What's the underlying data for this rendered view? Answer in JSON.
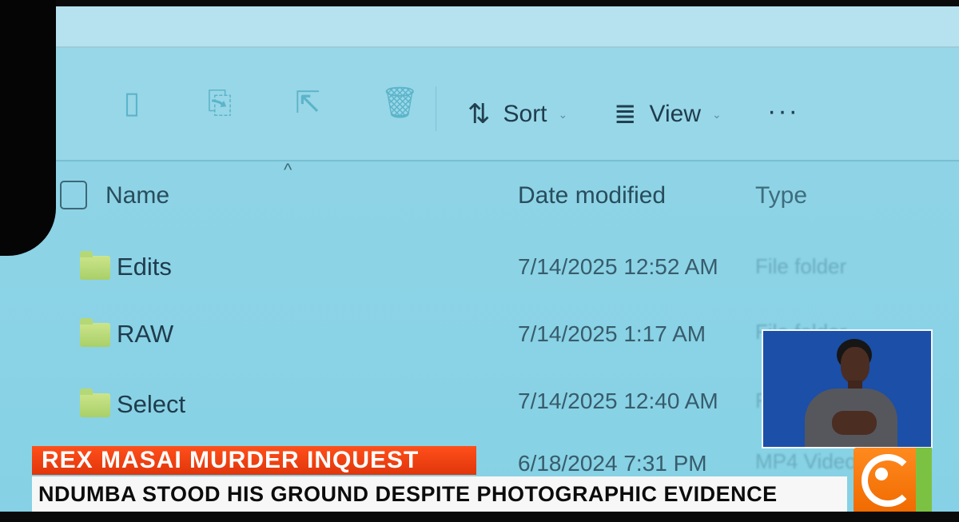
{
  "toolbar": {
    "sort_label": "Sort",
    "view_label": "View",
    "more_label": "···",
    "disabled_icons": [
      "copy-icon",
      "rename-icon",
      "share-icon",
      "delete-icon"
    ]
  },
  "columns": {
    "name": "Name",
    "date": "Date modified",
    "type": "Type"
  },
  "rows": [
    {
      "name": "Edits",
      "date": "7/14/2025 12:52 AM",
      "type": "File folder"
    },
    {
      "name": "RAW",
      "date": "7/14/2025 1:17 AM",
      "type": "File folder"
    },
    {
      "name": "Select",
      "date": "7/14/2025 12:40 AM",
      "type": "F"
    },
    {
      "name": "",
      "date": "6/18/2024 7:31 PM",
      "type": "MP4 Video"
    }
  ],
  "broadcast": {
    "headline": "REX MASAI MURDER INQUEST",
    "subheadline": "NDUMBA STOOD HIS GROUND DESPITE PHOTOGRAPHIC EVIDENCE"
  },
  "colors": {
    "headline_bg": "#f0400f",
    "subheadline_bg": "#f7f7f7",
    "logo_orange": "#f07a10",
    "logo_green": "#7cc242",
    "screen_bg": "#8fd4e6"
  }
}
